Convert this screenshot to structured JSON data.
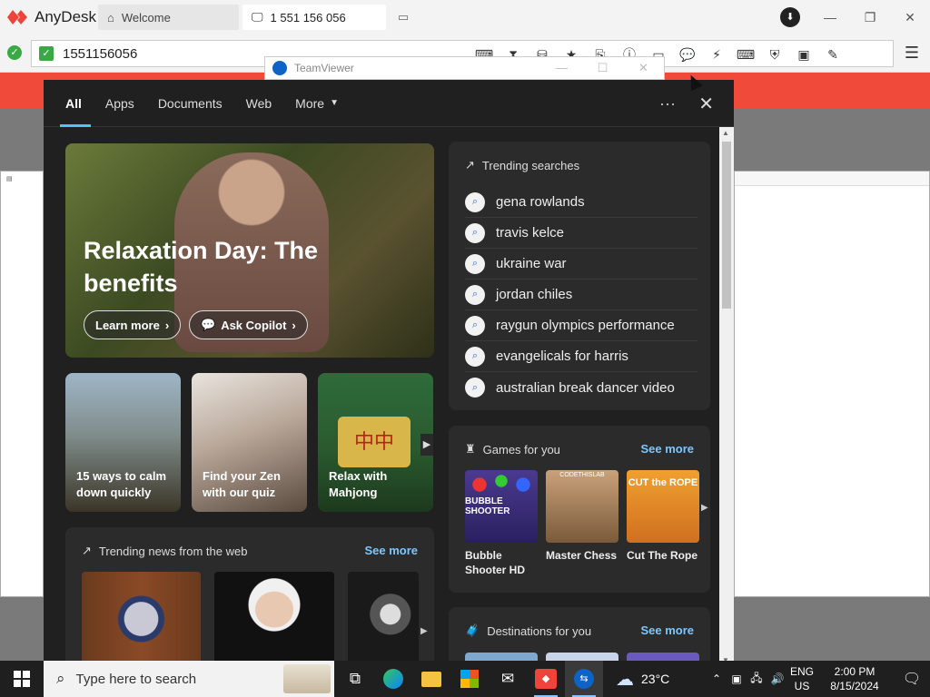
{
  "anydesk": {
    "app_name": "AnyDesk",
    "tabs": [
      {
        "label": "Welcome",
        "icon": "home-icon"
      },
      {
        "label": "1 551 156 056",
        "icon": "monitor-icon"
      }
    ],
    "address_value": "1551156056"
  },
  "teamviewer": {
    "title": "TeamViewer"
  },
  "search_panel": {
    "nav_tabs": [
      "All",
      "Apps",
      "Documents",
      "Web",
      "More"
    ],
    "hero": {
      "title": "Relaxation Day: The benefits",
      "learn_more": "Learn more",
      "ask_copilot": "Ask Copilot"
    },
    "tiles": [
      {
        "label": "15 ways to calm down quickly"
      },
      {
        "label": "Find your Zen with our quiz"
      },
      {
        "label": "Relax with Mahjong"
      }
    ],
    "trending_searches": {
      "title": "Trending searches",
      "items": [
        "gena rowlands",
        "travis kelce",
        "ukraine war",
        "jordan chiles",
        "raygun olympics performance",
        "evangelicals for harris",
        "australian break dancer video"
      ]
    },
    "games": {
      "title": "Games for you",
      "see_more": "See more",
      "items": [
        {
          "name": "Bubble Shooter HD",
          "thumb_text": "BUBBLE SHOOTER"
        },
        {
          "name": "Master Chess",
          "thumb_text": "CODETHISLAB"
        },
        {
          "name": "Cut The Rope",
          "thumb_text": "CUT the ROPE"
        }
      ]
    },
    "trending_news": {
      "title": "Trending news from the web",
      "see_more": "See more"
    },
    "destinations": {
      "title": "Destinations for you",
      "see_more": "See more"
    }
  },
  "taskbar": {
    "search_placeholder": "Type here to search",
    "weather": "23°C",
    "lang_line1": "ENG",
    "lang_line2": "US",
    "time": "2:00 PM",
    "date": "8/15/2024"
  },
  "colors": {
    "accent_blue": "#4cc2ff",
    "see_more": "#7cc6ff",
    "anydesk_red": "#ef443b",
    "panel_bg": "#202020",
    "card_bg": "#2b2b2b"
  }
}
